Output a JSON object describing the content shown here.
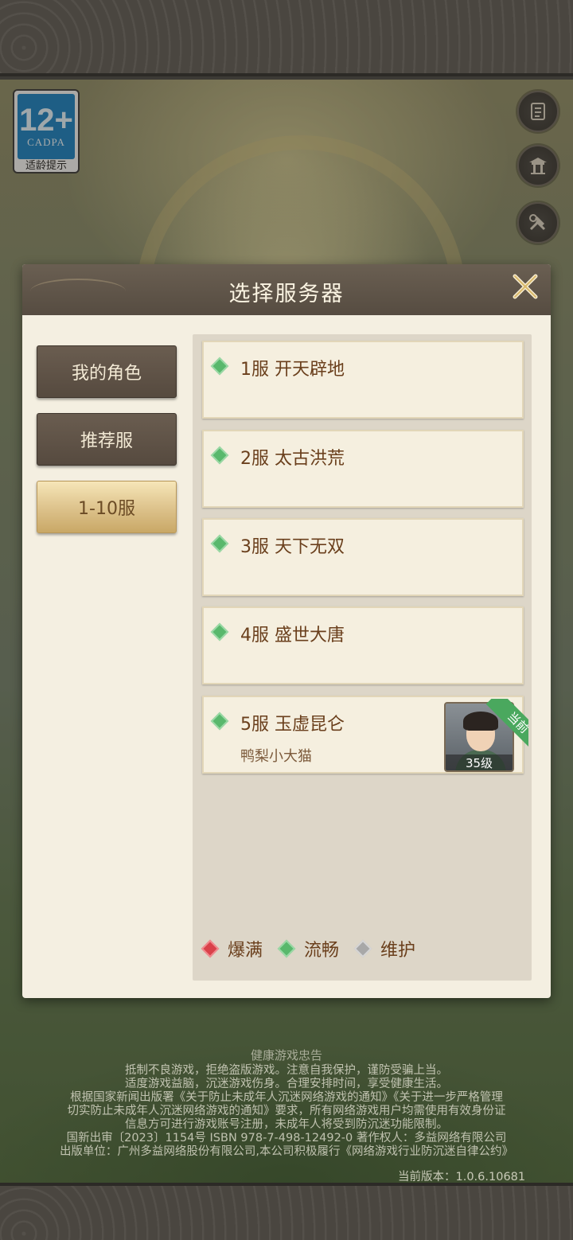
{
  "age_rating": {
    "number": "12+",
    "org": "CADPA",
    "label": "适龄提示"
  },
  "side_icons": [
    "notice-scroll-icon",
    "pavilion-icon",
    "tools-icon"
  ],
  "modal": {
    "title": "选择服务器",
    "close_icon": "close-x-icon"
  },
  "tabs": [
    {
      "label": "我的角色",
      "active": false
    },
    {
      "label": "推荐服",
      "active": false
    },
    {
      "label": "1-10服",
      "active": true
    }
  ],
  "servers": [
    {
      "name": "1服 开天辟地",
      "status": "流畅"
    },
    {
      "name": "2服 太古洪荒",
      "status": "流畅"
    },
    {
      "name": "3服 天下无双",
      "status": "流畅"
    },
    {
      "name": "4服 盛世大唐",
      "status": "流畅"
    },
    {
      "name": "5服 玉虚昆仑",
      "status": "流畅",
      "role": "鸭梨小大猫",
      "level": "35级",
      "tag": "当前"
    }
  ],
  "legend": [
    {
      "label": "爆满",
      "color": "#d9414a"
    },
    {
      "label": "流畅",
      "color": "#59b86c"
    },
    {
      "label": "维护",
      "color": "#a8a8a8"
    }
  ],
  "notice": {
    "title": "健康游戏忠告",
    "lines": [
      "抵制不良游戏，拒绝盗版游戏。注意自我保护，谨防受骗上当。",
      "适度游戏益脑，沉迷游戏伤身。合理安排时间，享受健康生活。",
      "根据国家新闻出版署《关于防止未成年人沉迷网络游戏的通知》《关于进一步严格管理",
      "切实防止未成年人沉迷网络游戏的通知》要求，所有网络游戏用户均需使用有效身份证",
      "信息方可进行游戏账号注册，未成年人将受到防沉迷功能限制。",
      "国新出审〔2023〕1154号 ISBN 978-7-498-12492-0 著作权人：多益网络有限公司",
      "出版单位：广州多益网络股份有限公司,本公司积极履行《网络游戏行业防沉迷自律公约》"
    ],
    "version": "当前版本：1.0.6.10681"
  }
}
